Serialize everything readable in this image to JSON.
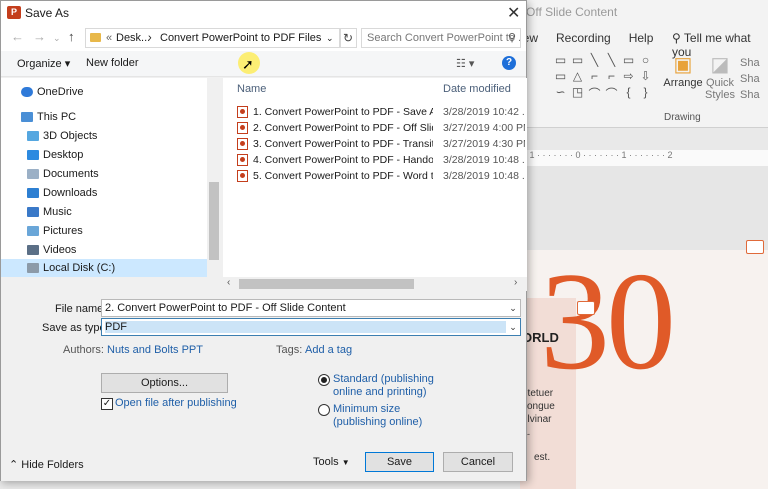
{
  "dialog": {
    "title": "Save As",
    "close": "✕",
    "address": {
      "sep": "«",
      "crumb1": "Desk...",
      "arrow": "›",
      "crumb2": "Convert PowerPoint to PDF Files"
    },
    "search_placeholder": "Search Convert PowerPoint to ...",
    "organize": "Organize ▾",
    "new_folder": "New folder",
    "nav_items": [
      {
        "label": "OneDrive"
      },
      {
        "label": "This PC"
      },
      {
        "label": "3D Objects"
      },
      {
        "label": "Desktop"
      },
      {
        "label": "Documents"
      },
      {
        "label": "Downloads"
      },
      {
        "label": "Music"
      },
      {
        "label": "Pictures"
      },
      {
        "label": "Videos"
      },
      {
        "label": "Local Disk (C:)"
      }
    ],
    "columns": {
      "name": "Name",
      "date": "Date modified"
    },
    "files": [
      {
        "name": "1. Convert PowerPoint to PDF - Save As ...",
        "date": "3/28/2019 10:42 ..."
      },
      {
        "name": "2. Convert PowerPoint to PDF - Off Slide ...",
        "date": "3/27/2019 4:00 PM"
      },
      {
        "name": "3. Convert PowerPoint to PDF - Transition...",
        "date": "3/27/2019 4:30 PM"
      },
      {
        "name": "4. Convert PowerPoint to PDF - Handouts",
        "date": "3/28/2019 10:48 ..."
      },
      {
        "name": "5. Convert PowerPoint to PDF - Word to ...",
        "date": "3/28/2019 10:48 ..."
      }
    ],
    "file_name_label": "File name:",
    "file_name_value": "2. Convert PowerPoint to PDF - Off Slide Content",
    "save_type_label": "Save as type:",
    "save_type_value": "PDF",
    "authors_label": "Authors:",
    "authors_value": "Nuts and Bolts PPT",
    "tags_label": "Tags:",
    "tags_value": "Add a tag",
    "options_button": "Options...",
    "open_after_label": "Open file after publishing",
    "radio_standard": "Standard (publishing",
    "radio_standard2": "online and printing)",
    "radio_minimum": "Minimum size",
    "radio_minimum2": "(publishing online)",
    "hide_folders": "Hide Folders",
    "tools": "Tools",
    "save": "Save",
    "cancel": "Cancel"
  },
  "powerpoint": {
    "title": "Off Slide Content",
    "tabs": [
      "iew",
      "Recording",
      "Help"
    ],
    "tell_me": "Tell me what you",
    "arrange": "Arrange",
    "quick": "Quick",
    "styles": "Styles",
    "share1": "Sha",
    "share2": "Sha",
    "share3": "Sha",
    "drawing": "Drawing",
    "big_number": "30",
    "orld": "ORLD",
    "text1": "etetuer",
    "text2": "congue",
    "text3": "ulvinar",
    "text4": "a.",
    "text5": "est."
  },
  "colors": {
    "accent": "#e05a28",
    "link": "#1f5fa8",
    "selection": "#cce8ff"
  }
}
